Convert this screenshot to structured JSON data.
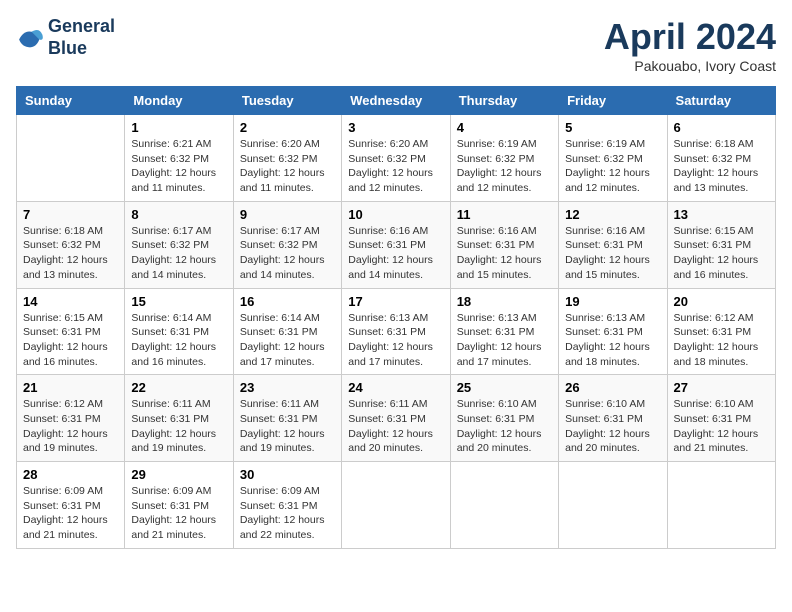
{
  "header": {
    "logo_line1": "General",
    "logo_line2": "Blue",
    "month": "April 2024",
    "location": "Pakouabo, Ivory Coast"
  },
  "weekdays": [
    "Sunday",
    "Monday",
    "Tuesday",
    "Wednesday",
    "Thursday",
    "Friday",
    "Saturday"
  ],
  "weeks": [
    [
      {
        "day": "",
        "info": ""
      },
      {
        "day": "1",
        "info": "Sunrise: 6:21 AM\nSunset: 6:32 PM\nDaylight: 12 hours\nand 11 minutes."
      },
      {
        "day": "2",
        "info": "Sunrise: 6:20 AM\nSunset: 6:32 PM\nDaylight: 12 hours\nand 11 minutes."
      },
      {
        "day": "3",
        "info": "Sunrise: 6:20 AM\nSunset: 6:32 PM\nDaylight: 12 hours\nand 12 minutes."
      },
      {
        "day": "4",
        "info": "Sunrise: 6:19 AM\nSunset: 6:32 PM\nDaylight: 12 hours\nand 12 minutes."
      },
      {
        "day": "5",
        "info": "Sunrise: 6:19 AM\nSunset: 6:32 PM\nDaylight: 12 hours\nand 12 minutes."
      },
      {
        "day": "6",
        "info": "Sunrise: 6:18 AM\nSunset: 6:32 PM\nDaylight: 12 hours\nand 13 minutes."
      }
    ],
    [
      {
        "day": "7",
        "info": "Sunrise: 6:18 AM\nSunset: 6:32 PM\nDaylight: 12 hours\nand 13 minutes."
      },
      {
        "day": "8",
        "info": "Sunrise: 6:17 AM\nSunset: 6:32 PM\nDaylight: 12 hours\nand 14 minutes."
      },
      {
        "day": "9",
        "info": "Sunrise: 6:17 AM\nSunset: 6:32 PM\nDaylight: 12 hours\nand 14 minutes."
      },
      {
        "day": "10",
        "info": "Sunrise: 6:16 AM\nSunset: 6:31 PM\nDaylight: 12 hours\nand 14 minutes."
      },
      {
        "day": "11",
        "info": "Sunrise: 6:16 AM\nSunset: 6:31 PM\nDaylight: 12 hours\nand 15 minutes."
      },
      {
        "day": "12",
        "info": "Sunrise: 6:16 AM\nSunset: 6:31 PM\nDaylight: 12 hours\nand 15 minutes."
      },
      {
        "day": "13",
        "info": "Sunrise: 6:15 AM\nSunset: 6:31 PM\nDaylight: 12 hours\nand 16 minutes."
      }
    ],
    [
      {
        "day": "14",
        "info": "Sunrise: 6:15 AM\nSunset: 6:31 PM\nDaylight: 12 hours\nand 16 minutes."
      },
      {
        "day": "15",
        "info": "Sunrise: 6:14 AM\nSunset: 6:31 PM\nDaylight: 12 hours\nand 16 minutes."
      },
      {
        "day": "16",
        "info": "Sunrise: 6:14 AM\nSunset: 6:31 PM\nDaylight: 12 hours\nand 17 minutes."
      },
      {
        "day": "17",
        "info": "Sunrise: 6:13 AM\nSunset: 6:31 PM\nDaylight: 12 hours\nand 17 minutes."
      },
      {
        "day": "18",
        "info": "Sunrise: 6:13 AM\nSunset: 6:31 PM\nDaylight: 12 hours\nand 17 minutes."
      },
      {
        "day": "19",
        "info": "Sunrise: 6:13 AM\nSunset: 6:31 PM\nDaylight: 12 hours\nand 18 minutes."
      },
      {
        "day": "20",
        "info": "Sunrise: 6:12 AM\nSunset: 6:31 PM\nDaylight: 12 hours\nand 18 minutes."
      }
    ],
    [
      {
        "day": "21",
        "info": "Sunrise: 6:12 AM\nSunset: 6:31 PM\nDaylight: 12 hours\nand 19 minutes."
      },
      {
        "day": "22",
        "info": "Sunrise: 6:11 AM\nSunset: 6:31 PM\nDaylight: 12 hours\nand 19 minutes."
      },
      {
        "day": "23",
        "info": "Sunrise: 6:11 AM\nSunset: 6:31 PM\nDaylight: 12 hours\nand 19 minutes."
      },
      {
        "day": "24",
        "info": "Sunrise: 6:11 AM\nSunset: 6:31 PM\nDaylight: 12 hours\nand 20 minutes."
      },
      {
        "day": "25",
        "info": "Sunrise: 6:10 AM\nSunset: 6:31 PM\nDaylight: 12 hours\nand 20 minutes."
      },
      {
        "day": "26",
        "info": "Sunrise: 6:10 AM\nSunset: 6:31 PM\nDaylight: 12 hours\nand 20 minutes."
      },
      {
        "day": "27",
        "info": "Sunrise: 6:10 AM\nSunset: 6:31 PM\nDaylight: 12 hours\nand 21 minutes."
      }
    ],
    [
      {
        "day": "28",
        "info": "Sunrise: 6:09 AM\nSunset: 6:31 PM\nDaylight: 12 hours\nand 21 minutes."
      },
      {
        "day": "29",
        "info": "Sunrise: 6:09 AM\nSunset: 6:31 PM\nDaylight: 12 hours\nand 21 minutes."
      },
      {
        "day": "30",
        "info": "Sunrise: 6:09 AM\nSunset: 6:31 PM\nDaylight: 12 hours\nand 22 minutes."
      },
      {
        "day": "",
        "info": ""
      },
      {
        "day": "",
        "info": ""
      },
      {
        "day": "",
        "info": ""
      },
      {
        "day": "",
        "info": ""
      }
    ]
  ]
}
